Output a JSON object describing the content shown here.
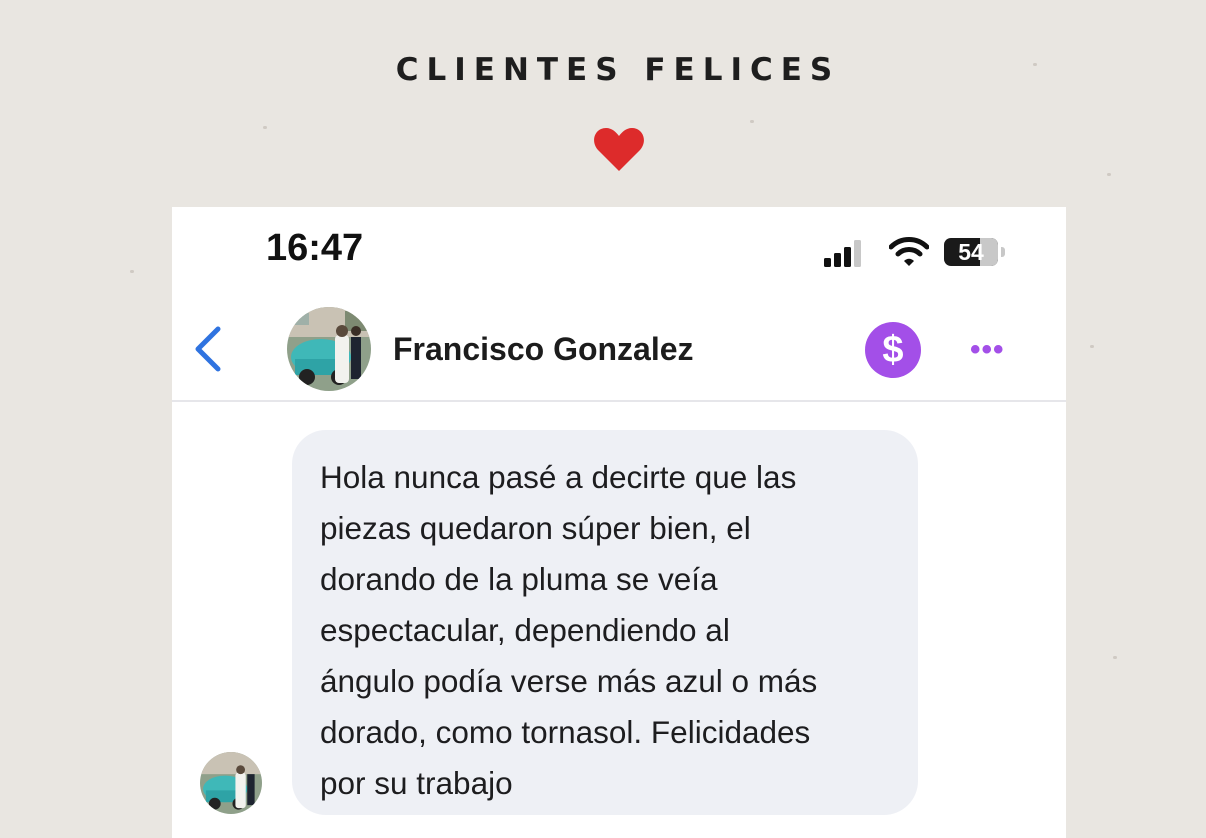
{
  "header": {
    "title": "CLIENTES FELICES",
    "heart_icon": "heart-icon",
    "heart_color": "#dd2b2b"
  },
  "status_bar": {
    "time": "16:47",
    "battery": "54",
    "signal_icon": "cellular-signal-icon",
    "wifi_icon": "wifi-icon"
  },
  "chat_header": {
    "back_icon": "chevron-left-icon",
    "contact_name": "Francisco Gonzalez",
    "pay_symbol": "$",
    "more_symbol": "•••",
    "accent_color": "#a34fe8",
    "back_color": "#2f73e0"
  },
  "messages": [
    {
      "from": "contact",
      "text": "Hola nunca pasé a decirte que las\npiezas quedaron súper bien, el\ndorando de la pluma se veía\nespectacular, dependiendo al\nángulo podía verse más azul o más\ndorado, como tornasol. Felicidades\npor su trabajo"
    }
  ]
}
